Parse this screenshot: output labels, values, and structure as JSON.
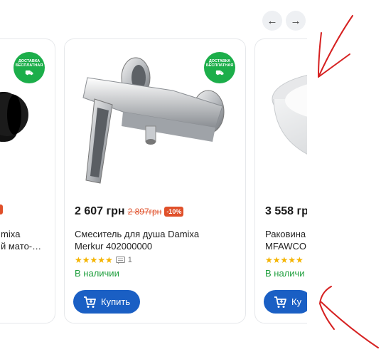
{
  "carousel": {
    "prev_icon": "arrow-left-icon",
    "next_icon": "arrow-right-icon"
  },
  "badge": {
    "line1": "ДОСТАВКА",
    "line2": "БЕСПЛАТНАЯ",
    "icon": "truck-icon",
    "color": "#1cae4a"
  },
  "products": [
    {
      "price": "",
      "old_price": "",
      "discount": "",
      "name_line1": "mixa",
      "name_line2": "й мато-…",
      "stock": "",
      "buy_label": "",
      "image": "black-faucet-image"
    },
    {
      "price": "2 607 грн",
      "old_price": "2 897грн",
      "discount": "-10%",
      "name_line1": "Смеситель для душа Damixa",
      "name_line2": "Merkur 402000000",
      "rating": 5,
      "reviews": "1",
      "stock": "В наличии",
      "buy_label": "Купить",
      "image": "chrome-shower-mixer-image"
    },
    {
      "price": "3 558 гр",
      "name_line1": "Раковина",
      "name_line2": "MFAWCO",
      "rating": 5,
      "stock": "В наличи",
      "buy_label": "Ку",
      "image": "white-sink-image"
    }
  ],
  "colors": {
    "accent": "#1a5fc4",
    "in_stock": "#1e9e3c",
    "discount": "#e0502a",
    "star": "#f5b400"
  }
}
